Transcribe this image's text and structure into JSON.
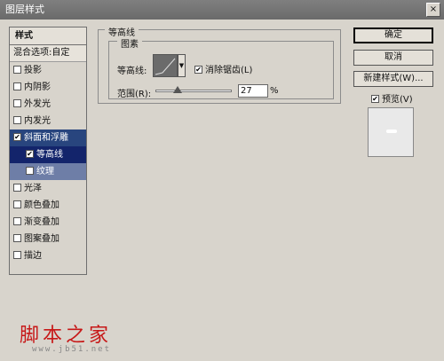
{
  "window": {
    "title": "图层样式",
    "close_label": "×"
  },
  "sidebar": {
    "header": "样式",
    "blend_row": "混合选项:自定",
    "items": [
      {
        "label": "投影",
        "checked": false
      },
      {
        "label": "内阴影",
        "checked": false
      },
      {
        "label": "外发光",
        "checked": false
      },
      {
        "label": "内发光",
        "checked": false
      },
      {
        "label": "斜面和浮雕",
        "checked": true
      },
      {
        "label": "等高线",
        "checked": true
      },
      {
        "label": "纹理",
        "checked": false
      },
      {
        "label": "光泽",
        "checked": false
      },
      {
        "label": "颜色叠加",
        "checked": false
      },
      {
        "label": "渐变叠加",
        "checked": false
      },
      {
        "label": "图案叠加",
        "checked": false
      },
      {
        "label": "描边",
        "checked": false
      }
    ]
  },
  "contour_panel": {
    "title": "等高线",
    "group_title": "图素",
    "contour_label": "等高线:",
    "antialias_label": "消除锯齿(L)",
    "antialias_checked": true,
    "range_label": "范围(R):",
    "range_value": "27",
    "range_unit": "%"
  },
  "buttons": {
    "ok": "确定",
    "cancel": "取消",
    "new_style": "新建样式(W)...",
    "preview_label": "预览(V)",
    "preview_checked": true
  },
  "watermark": {
    "site_name": "脚本之家",
    "url": "www.jb51.net"
  }
}
